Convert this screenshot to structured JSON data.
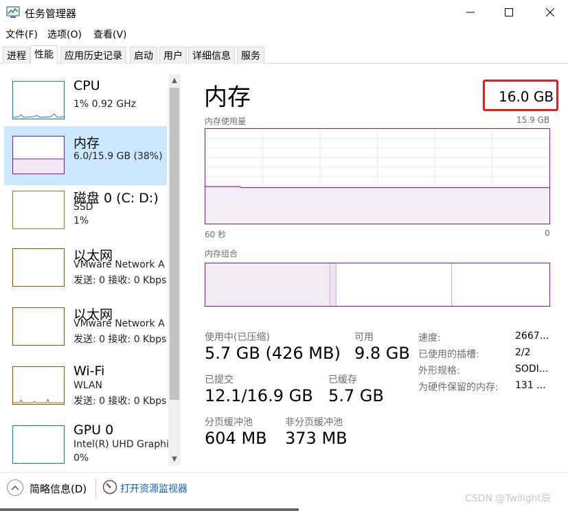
{
  "window": {
    "title": "任务管理器",
    "controls": {
      "minimize": "—",
      "maximize": "☐",
      "close": "✕"
    }
  },
  "menu": [
    "文件(F)",
    "选项(O)",
    "查看(V)"
  ],
  "tabs": [
    {
      "label": "进程",
      "active": false
    },
    {
      "label": "性能",
      "active": true
    },
    {
      "label": "应用历史记录",
      "active": false
    },
    {
      "label": "启动",
      "active": false
    },
    {
      "label": "用户",
      "active": false
    },
    {
      "label": "详细信息",
      "active": false
    },
    {
      "label": "服务",
      "active": false
    }
  ],
  "sidebar": {
    "items": [
      {
        "title": "CPU",
        "lines": [
          "1% 0.92 GHz"
        ],
        "color": "#117dbb",
        "selected": false
      },
      {
        "title": "内存",
        "lines": [
          "6.0/15.9 GB (38%)"
        ],
        "color": "#8b12ae",
        "selected": true
      },
      {
        "title": "磁盘 0 (C: D:)",
        "lines": [
          "SSD",
          "1%"
        ],
        "color": "#4da60c",
        "selected": false
      },
      {
        "title": "以太网",
        "lines": [
          "VMware Network A",
          "发送: 0 接收: 0 Kbps"
        ],
        "color": "#a74f01",
        "selected": false
      },
      {
        "title": "以太网",
        "lines": [
          "VMware Network A",
          "发送: 0 接收: 0 Kbps"
        ],
        "color": "#a74f01",
        "selected": false
      },
      {
        "title": "Wi-Fi",
        "lines": [
          "WLAN",
          "发送: 0 接收: 0 Kbps"
        ],
        "color": "#a74f01",
        "selected": false
      },
      {
        "title": "GPU 0",
        "lines": [
          "Intel(R) UHD Graphics",
          "0%"
        ],
        "color": "#117dbb",
        "selected": false
      }
    ]
  },
  "main": {
    "title": "内存",
    "total": "16.0 GB",
    "usage_label": "内存使用量",
    "usage_max": "15.9 GB",
    "axis_left": "60 秒",
    "axis_right": "0",
    "usage_fraction": 0.38,
    "composition_label": "内存组合",
    "stats": {
      "in_use_label": "使用中(已压缩)",
      "in_use_value": "5.7 GB (426 MB)",
      "available_label": "可用",
      "available_value": "9.8 GB",
      "committed_label": "已提交",
      "committed_value": "12.1/16.9 GB",
      "cached_label": "已缓存",
      "cached_value": "5.7 GB",
      "paged_label": "分页缓冲池",
      "paged_value": "604 MB",
      "nonpaged_label": "非分页缓冲池",
      "nonpaged_value": "373 MB"
    },
    "details": [
      {
        "label": "速度:",
        "value": "2667..."
      },
      {
        "label": "已使用的插槽:",
        "value": "2/2"
      },
      {
        "label": "外形规格:",
        "value": "SODI..."
      },
      {
        "label": "为硬件保留的内存:",
        "value": "131 ..."
      }
    ]
  },
  "footer": {
    "collapse_label": "简略信息(D)",
    "monitor_link": "打开资源监视器",
    "watermark": "CSDN @Twilight辰"
  },
  "colors": {
    "memory": "#8b12ae",
    "memory_fill": "#f4f2f4",
    "highlight_box": "#e02020",
    "selection": "#cce8ff",
    "link": "#0b5fc6"
  }
}
